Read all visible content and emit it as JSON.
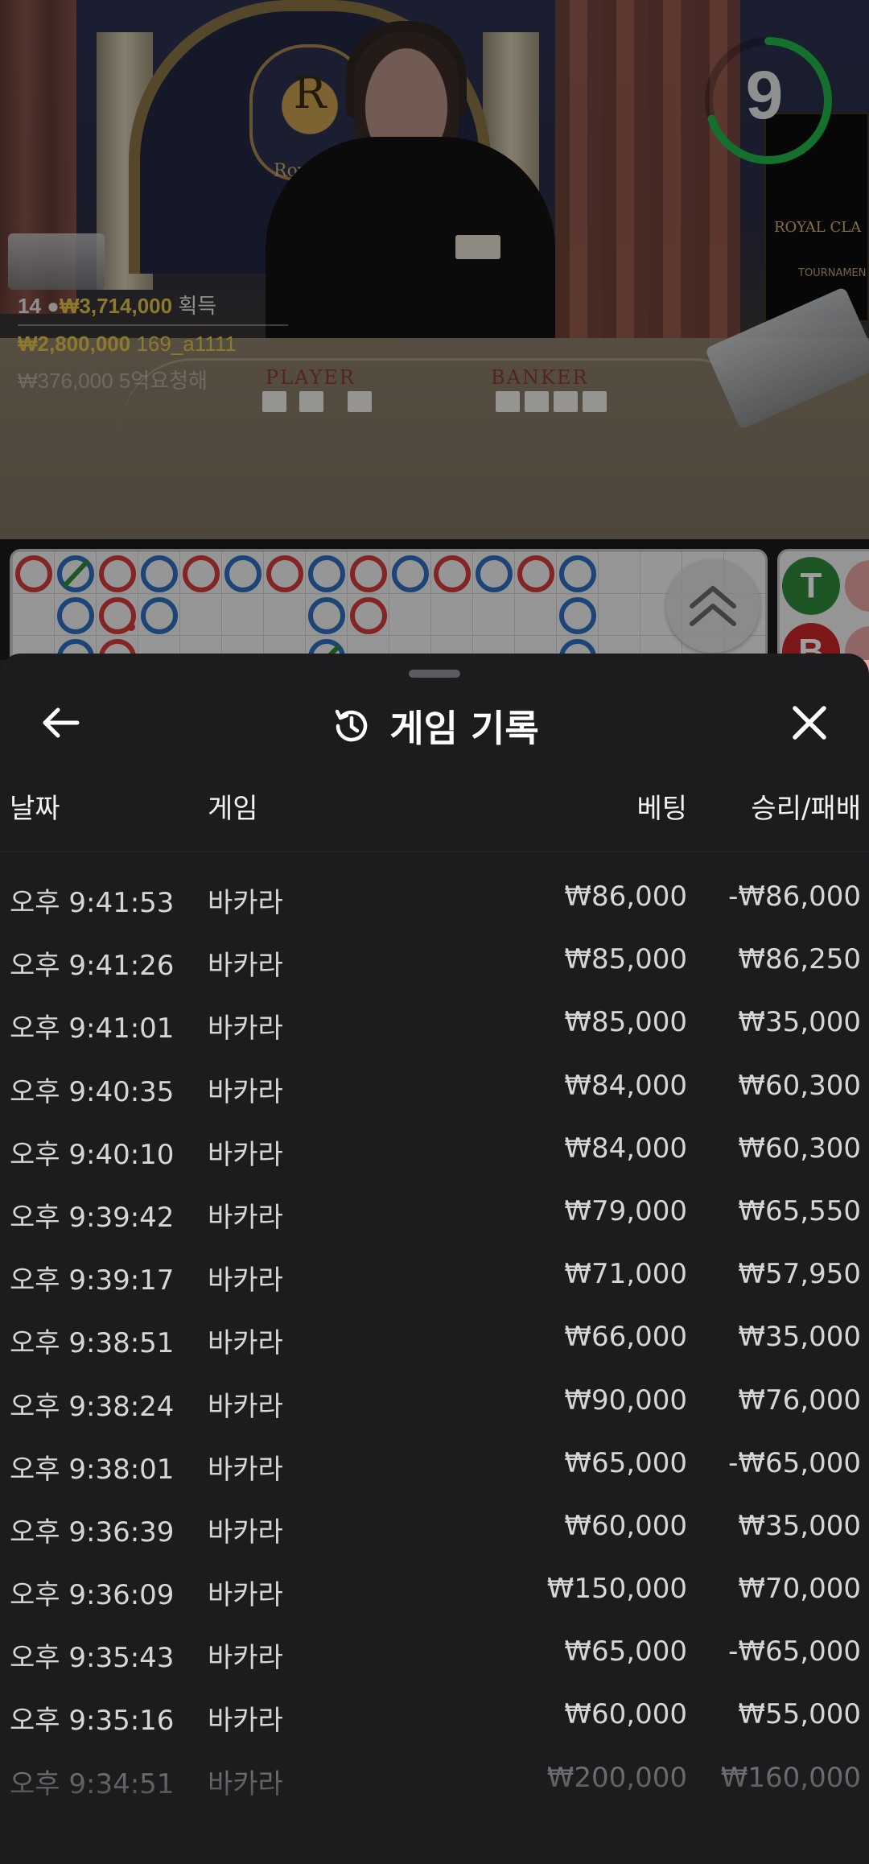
{
  "stream": {
    "countdown": "9",
    "countdown_fraction": 0.7,
    "crest_text": "Royal",
    "sign_line1": "ROYAL CLA",
    "sign_line2": "TOURNAMEN",
    "table_player": "PLAYER",
    "table_banker": "BANKER",
    "winners": [
      {
        "count": "14",
        "amount": "₩3,714,000",
        "suffix": "획득"
      },
      {
        "amount": "₩2,800,000",
        "user": "169_a1111"
      },
      {
        "amount": "₩376,000",
        "user": "5억요청해"
      }
    ]
  },
  "roadmap": {
    "badge_tie": "T",
    "badge_banker": "B",
    "colors": {
      "red": "#d33a3d",
      "blue": "#2f6fbf",
      "green": "#2f8a3b"
    }
  },
  "history": {
    "title": "게임 기록",
    "columns": {
      "date": "날짜",
      "game": "게임",
      "bet": "베팅",
      "winloss": "승리/패배"
    },
    "rows": [
      {
        "time": "오후 9:41:53",
        "game": "바카라",
        "bet": "₩86,000",
        "result": "-₩86,000"
      },
      {
        "time": "오후 9:41:26",
        "game": "바카라",
        "bet": "₩85,000",
        "result": "₩86,250"
      },
      {
        "time": "오후 9:41:01",
        "game": "바카라",
        "bet": "₩85,000",
        "result": "₩35,000"
      },
      {
        "time": "오후 9:40:35",
        "game": "바카라",
        "bet": "₩84,000",
        "result": "₩60,300"
      },
      {
        "time": "오후 9:40:10",
        "game": "바카라",
        "bet": "₩84,000",
        "result": "₩60,300"
      },
      {
        "time": "오후 9:39:42",
        "game": "바카라",
        "bet": "₩79,000",
        "result": "₩65,550"
      },
      {
        "time": "오후 9:39:17",
        "game": "바카라",
        "bet": "₩71,000",
        "result": "₩57,950"
      },
      {
        "time": "오후 9:38:51",
        "game": "바카라",
        "bet": "₩66,000",
        "result": "₩35,000"
      },
      {
        "time": "오후 9:38:24",
        "game": "바카라",
        "bet": "₩90,000",
        "result": "₩76,000"
      },
      {
        "time": "오후 9:38:01",
        "game": "바카라",
        "bet": "₩65,000",
        "result": "-₩65,000"
      },
      {
        "time": "오후 9:36:39",
        "game": "바카라",
        "bet": "₩60,000",
        "result": "₩35,000"
      },
      {
        "time": "오후 9:36:09",
        "game": "바카라",
        "bet": "₩150,000",
        "result": "₩70,000"
      },
      {
        "time": "오후 9:35:43",
        "game": "바카라",
        "bet": "₩65,000",
        "result": "-₩65,000"
      },
      {
        "time": "오후 9:35:16",
        "game": "바카라",
        "bet": "₩60,000",
        "result": "₩55,000"
      },
      {
        "time": "오후 9:34:51",
        "game": "바카라",
        "bet": "₩200,000",
        "result": "₩160,000"
      }
    ]
  }
}
